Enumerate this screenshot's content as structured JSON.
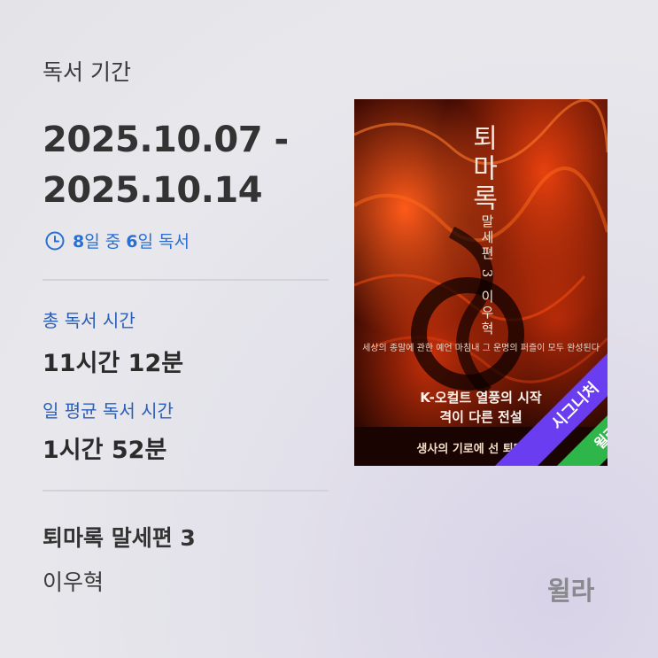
{
  "period": {
    "label": "독서 기간",
    "range_line1": "2025.10.07 -",
    "range_line2": "2025.10.14",
    "total_days": "8",
    "days_mid": "일 중 ",
    "read_days": "6",
    "days_suffix": "일 독서"
  },
  "stats": {
    "total_label": "총 독서 시간",
    "total_hours": "11",
    "total_hours_unit": "시간 ",
    "total_minutes": "12",
    "total_minutes_unit": "분",
    "avg_label": "일 평균 독서 시간",
    "avg_hours": "1",
    "avg_hours_unit": "시간 ",
    "avg_minutes": "52",
    "avg_minutes_unit": "분"
  },
  "book": {
    "title": "퇴마록 말세편 3",
    "author": "이우혁"
  },
  "cover": {
    "title": "퇴마록",
    "subtitle": "말세편 3",
    "author": "이우혁",
    "tagline": "세상의 종말에 관한 예언 마침내 그 운명의 퍼즐이 모두 완성된다",
    "headline1": "K-오컬트 열풍의 시작",
    "headline2": "격이 다른 전설",
    "footer": "생사의 기로에 선 퇴마사들"
  },
  "ribbons": {
    "signature": "시그니처",
    "brand": "윌라"
  },
  "brand": "윌라",
  "colors": {
    "accent_blue": "#2a6fd0",
    "ribbon_purple": "#6b3df0",
    "ribbon_green": "#2fb64a"
  },
  "icons": {
    "clock": "clock-icon"
  }
}
